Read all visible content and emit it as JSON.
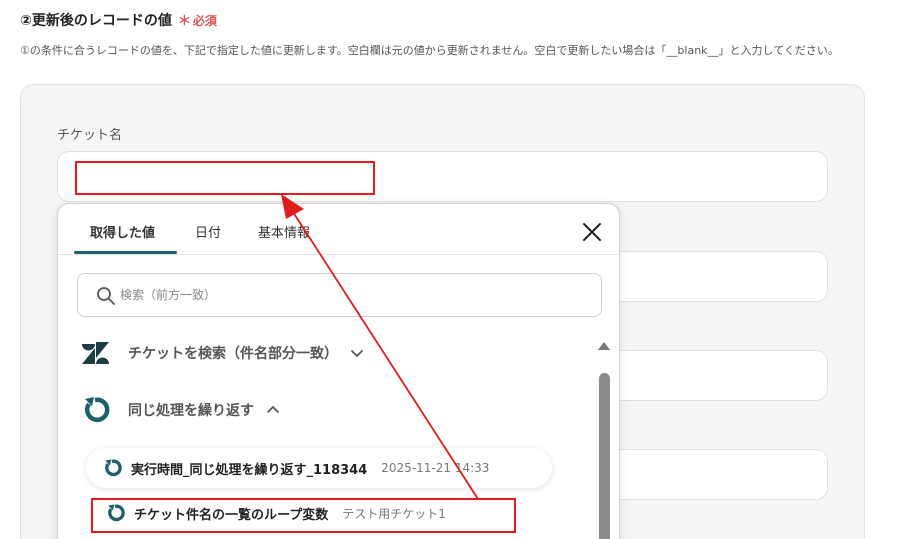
{
  "section": {
    "title": "②更新後のレコードの値",
    "required_mark": "＊",
    "required_label": "必須",
    "description": "①の条件に合うレコードの値を、下記で指定した値に更新します。空白欄は元の値から更新されません。空白で更新したい場合は「__blank__」と入力してください。"
  },
  "form": {
    "field_label": "チケット名",
    "field_value": ""
  },
  "panel": {
    "tabs": [
      {
        "label": "取得した値",
        "active": true
      },
      {
        "label": "日付",
        "active": false
      },
      {
        "label": "基本情報",
        "active": false
      }
    ],
    "search_placeholder": "検索（前方一致）",
    "groups": [
      {
        "label": "チケットを検索（件名部分一致）",
        "icon": "zendesk-logo-icon",
        "expanded": false
      },
      {
        "label": "同じ処理を繰り返す",
        "icon": "loop-icon",
        "expanded": true
      }
    ],
    "items": [
      {
        "name": "実行時間_同じ処理を繰り返す_118344",
        "value": "2025-11-21 14:33"
      },
      {
        "name": "チケット件名の一覧のループ変数",
        "value": "テスト用チケット1"
      }
    ]
  },
  "colors": {
    "accent": "#1e5f6e",
    "annotation": "#e21c1c",
    "required": "#e05555"
  }
}
